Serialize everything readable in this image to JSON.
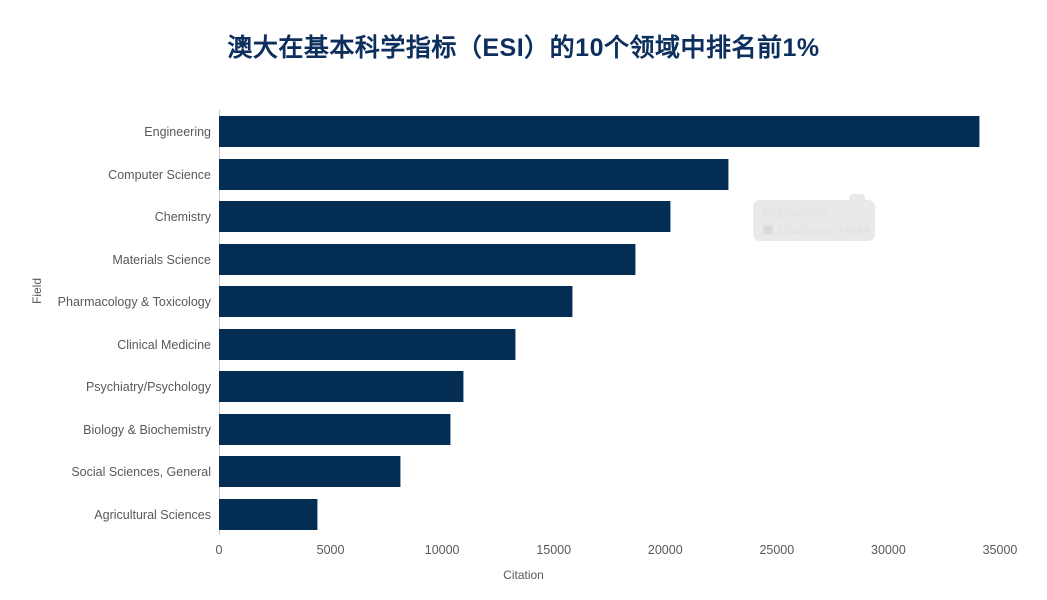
{
  "chart_data": {
    "type": "bar",
    "orientation": "horizontal",
    "title": "澳大在基本科学指标（ESI）的10个领域中排名前1%",
    "xlabel": "Citation",
    "ylabel": "Field",
    "categories": [
      "Engineering",
      "Computer Science",
      "Chemistry",
      "Materials Science",
      "Pharmacology & Toxicology",
      "Clinical Medicine",
      "Psychiatry/Psychology",
      "Biology & Biochemistry",
      "Social Sciences, General",
      "Agricultural Sciences"
    ],
    "values": [
      34064,
      22800,
      20200,
      18650,
      15800,
      13270,
      10950,
      10350,
      8100,
      4400
    ],
    "xlim": [
      0,
      35000
    ],
    "xticks": [
      0,
      5000,
      10000,
      15000,
      20000,
      25000,
      30000,
      35000
    ],
    "xtick_labels": [
      "0",
      "5000",
      "10000",
      "15000",
      "20000",
      "25000",
      "30000",
      "35000"
    ],
    "grid": false,
    "legend": false,
    "bar_color": "#042d54",
    "title_color": "#0d2f5e",
    "tick_color": "#595959"
  },
  "tooltip": {
    "title": "Engineering",
    "series_label": "Citations: 34064",
    "swatch_color": "#bfc4c9"
  }
}
